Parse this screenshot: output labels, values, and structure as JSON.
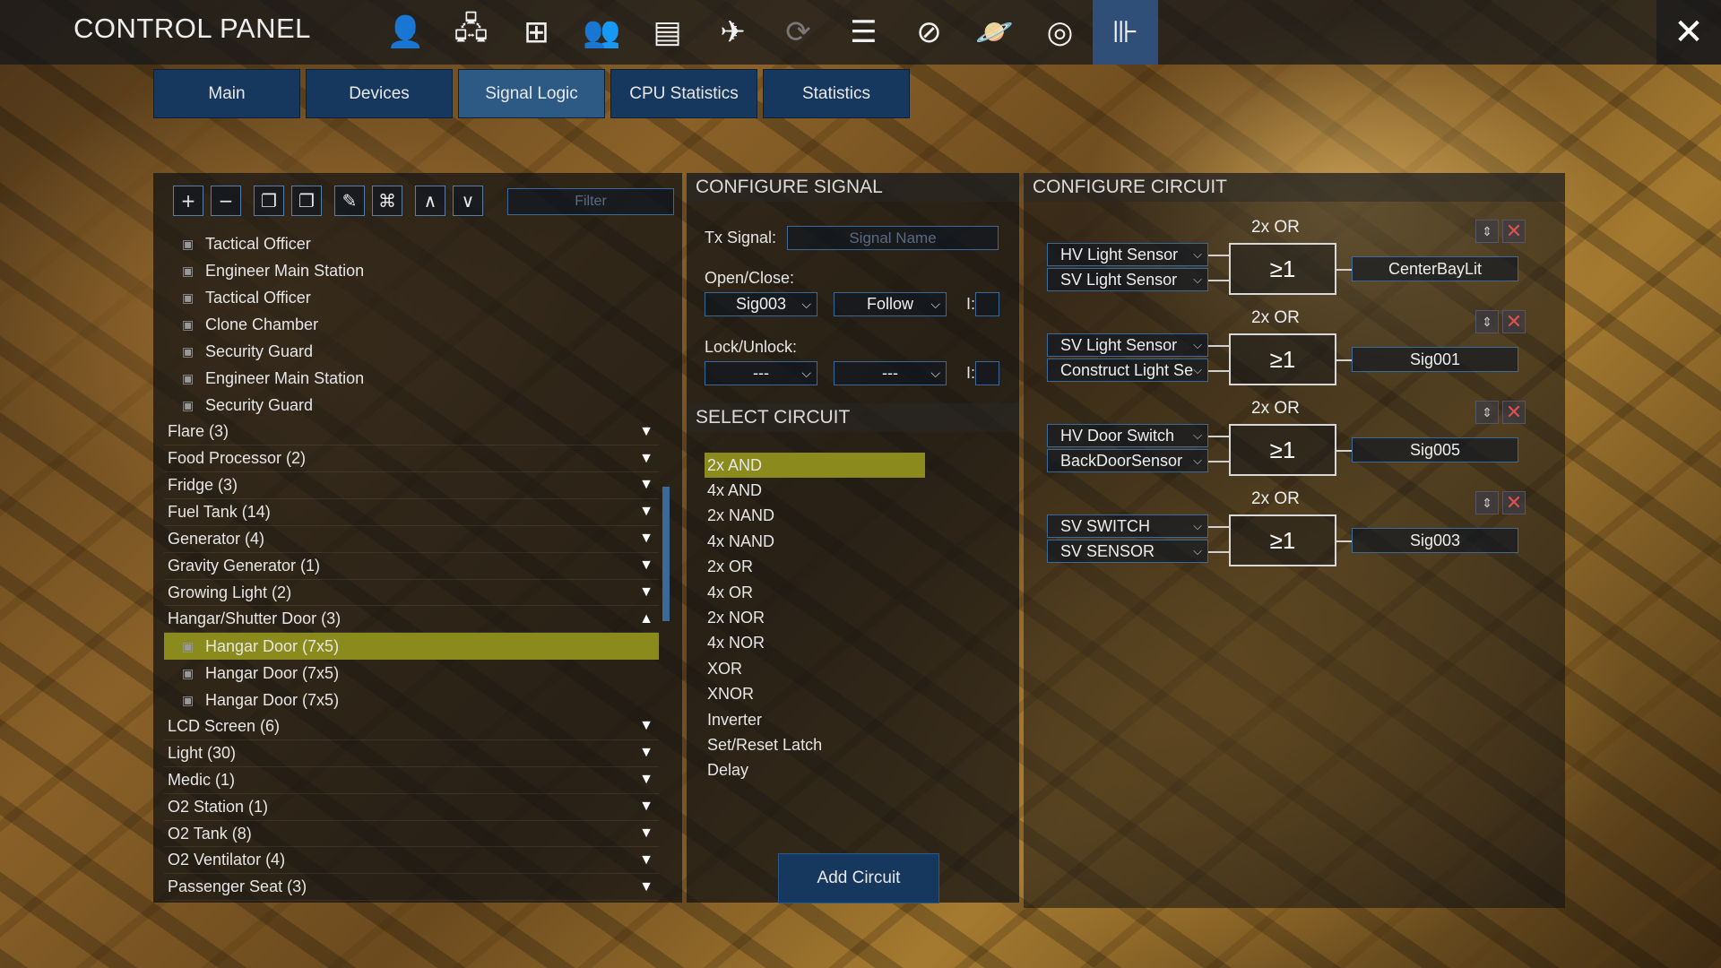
{
  "app": {
    "title": "CONTROL PANEL"
  },
  "topbar_icons": [
    {
      "name": "player-icon",
      "glyph": "👤"
    },
    {
      "name": "network-icon",
      "glyph": "🖧"
    },
    {
      "name": "structure-icon",
      "glyph": "⊞"
    },
    {
      "name": "faction-icon",
      "glyph": "👥"
    },
    {
      "name": "window-icon",
      "glyph": "▤"
    },
    {
      "name": "ship-icon",
      "glyph": "✈"
    },
    {
      "name": "sync-icon",
      "glyph": "⟳"
    },
    {
      "name": "list-icon",
      "glyph": "☰"
    },
    {
      "name": "compass-icon",
      "glyph": "⊘"
    },
    {
      "name": "planet-icon",
      "glyph": "🪐"
    },
    {
      "name": "galaxy-icon",
      "glyph": "◎"
    },
    {
      "name": "control-panel-icon",
      "glyph": "⊪"
    }
  ],
  "close_glyph": "✕",
  "tabs": [
    {
      "label": "Main"
    },
    {
      "label": "Devices"
    },
    {
      "label": "Signal Logic"
    },
    {
      "label": "CPU Statistics"
    },
    {
      "label": "Statistics"
    }
  ],
  "toolbar": {
    "buttons": [
      "+",
      "−",
      "❐",
      "❐",
      "✎",
      "⌘",
      "∧",
      "∨"
    ],
    "filter_placeholder": "Filter"
  },
  "device_list": [
    {
      "label": "Tactical Officer",
      "type": "child"
    },
    {
      "label": "Engineer Main Station",
      "type": "child"
    },
    {
      "label": "Tactical Officer",
      "type": "child"
    },
    {
      "label": "Clone Chamber",
      "type": "child"
    },
    {
      "label": "Security Guard",
      "type": "child"
    },
    {
      "label": "Engineer Main Station",
      "type": "child"
    },
    {
      "label": "Security Guard",
      "type": "child"
    },
    {
      "label": "Flare (3)",
      "type": "group",
      "arrow": "▼"
    },
    {
      "label": "Food Processor (2)",
      "type": "group",
      "arrow": "▼"
    },
    {
      "label": "Fridge (3)",
      "type": "group",
      "arrow": "▼"
    },
    {
      "label": "Fuel Tank (14)",
      "type": "group",
      "arrow": "▼"
    },
    {
      "label": "Generator (4)",
      "type": "group",
      "arrow": "▼"
    },
    {
      "label": "Gravity Generator (1)",
      "type": "group",
      "arrow": "▼"
    },
    {
      "label": "Growing Light (2)",
      "type": "group",
      "arrow": "▼"
    },
    {
      "label": "Hangar/Shutter Door (3)",
      "type": "group",
      "arrow": "▲"
    },
    {
      "label": "Hangar Door (7x5)",
      "type": "child",
      "selected": true
    },
    {
      "label": "Hangar Door (7x5)",
      "type": "child"
    },
    {
      "label": "Hangar Door (7x5)",
      "type": "child"
    },
    {
      "label": "LCD Screen (6)",
      "type": "group",
      "arrow": "▼"
    },
    {
      "label": "Light (30)",
      "type": "group",
      "arrow": "▼"
    },
    {
      "label": "Medic (1)",
      "type": "group",
      "arrow": "▼"
    },
    {
      "label": "O2 Station (1)",
      "type": "group",
      "arrow": "▼"
    },
    {
      "label": "O2 Tank (8)",
      "type": "group",
      "arrow": "▼"
    },
    {
      "label": "O2 Ventilator (4)",
      "type": "group",
      "arrow": "▼"
    },
    {
      "label": "Passenger Seat (3)",
      "type": "group",
      "arrow": "▼"
    }
  ],
  "configure_signal": {
    "header": "CONFIGURE SIGNAL",
    "tx_label": "Tx Signal:",
    "tx_placeholder": "Signal Name",
    "open_close_label": "Open/Close:",
    "open_close_signal": "Sig003",
    "open_close_mode": "Follow",
    "invert_label": "I:",
    "lock_label": "Lock/Unlock:",
    "lock_signal": "---",
    "lock_mode": "---",
    "chevron": "⌵"
  },
  "select_circuit": {
    "header": "SELECT CIRCUIT",
    "items": [
      "2x AND",
      "4x AND",
      "2x NAND",
      "4x NAND",
      "2x OR",
      "4x OR",
      "2x NOR",
      "4x NOR",
      "XOR",
      "XNOR",
      "Inverter",
      "Set/Reset Latch",
      "Delay"
    ],
    "selected_index": 0,
    "add_button": "Add Circuit"
  },
  "configure_circuit": {
    "header": "CONFIGURE CIRCUIT",
    "gate_symbol": "≥1",
    "circuits": [
      {
        "type": "2x OR",
        "inputs": [
          "HV Light Sensor",
          "SV Light Sensor"
        ],
        "output": "CenterBayLit"
      },
      {
        "type": "2x OR",
        "inputs": [
          "SV Light Sensor",
          "Construct Light Se"
        ],
        "output": "Sig001"
      },
      {
        "type": "2x OR",
        "inputs": [
          "HV Door Switch",
          "BackDoorSensor"
        ],
        "output": "Sig005"
      },
      {
        "type": "2x OR",
        "inputs": [
          "SV SWITCH",
          "SV SENSOR"
        ],
        "output": "Sig003"
      }
    ]
  },
  "colors": {
    "tab_active": "#2c5a85",
    "tab": "#16385e",
    "selection": "#8a8b1c",
    "border": "#3b6a9a",
    "delete": "#e05050"
  }
}
